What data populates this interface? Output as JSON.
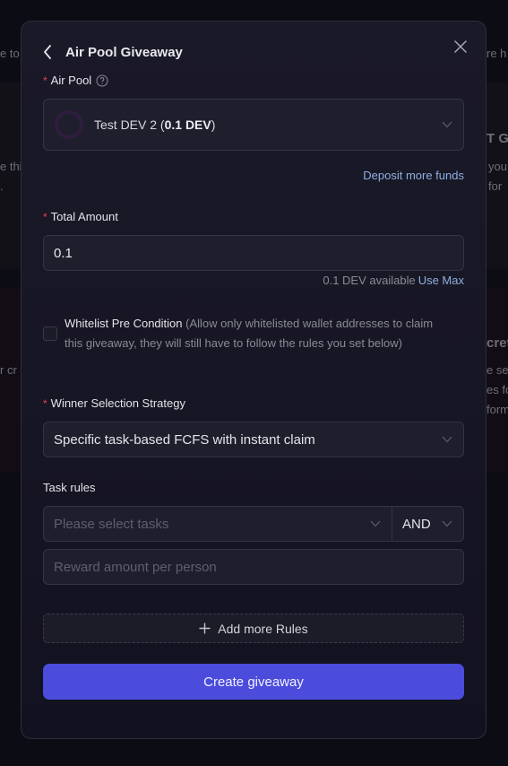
{
  "background": {
    "snippets": [
      "e to",
      "e thi",
      ".",
      "r cr",
      "re h",
      "T Gi",
      "you",
      "for",
      "cret",
      "e sec",
      "es fo",
      "form"
    ]
  },
  "modal": {
    "title": "Air Pool Giveaway",
    "air_pool": {
      "label": "Air Pool",
      "selected_name": "Test DEV 2 (",
      "selected_amount": "0.1 DEV",
      "selected_suffix": ")",
      "deposit_link": "Deposit more funds"
    },
    "total_amount": {
      "label": "Total Amount",
      "value": "0.1",
      "available": "0.1 DEV available",
      "use_max": "Use Max"
    },
    "whitelist": {
      "label": "Whitelist Pre Condition",
      "description": " (Allow only whitelisted wallet addresses to claim this giveaway, they will still have to follow the rules you set below)",
      "checked": false
    },
    "strategy": {
      "label": "Winner Selection Strategy",
      "selected": "Specific task-based FCFS with instant claim"
    },
    "task_rules": {
      "label": "Task rules",
      "tasks_placeholder": "Please select tasks",
      "operator": "AND",
      "reward_placeholder": "Reward amount per person"
    },
    "add_rules_label": "Add more Rules",
    "create_label": "Create giveaway"
  },
  "colors": {
    "accent": "#4b4cdc",
    "link": "#8fb0e0",
    "required": "#e5484d"
  }
}
